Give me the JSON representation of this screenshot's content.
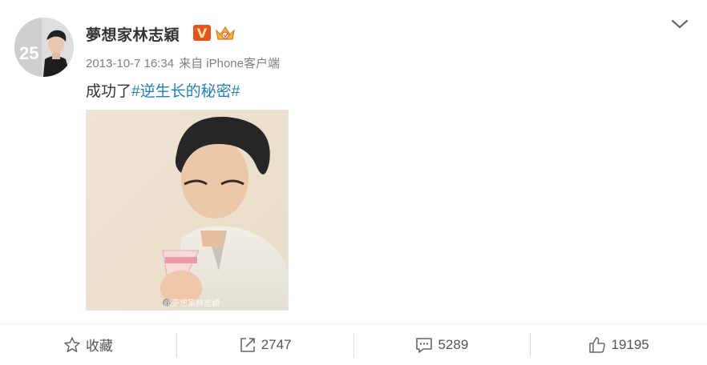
{
  "post": {
    "username": "夢想家林志穎",
    "verified_badge": "V",
    "badge_icons": [
      "verified-v-icon",
      "crown-badge-icon"
    ],
    "timestamp": "2013-10-7 16:34",
    "source": "来自 iPhone客户端",
    "text_prefix": "成功了",
    "hashtag": "#逆生长的秘密#",
    "avatar_overlay": "25",
    "image_watermark": "@夢想家林志穎"
  },
  "actions": [
    {
      "icon": "star-icon",
      "label": "收藏"
    },
    {
      "icon": "share-icon",
      "label": "2747"
    },
    {
      "icon": "comment-icon",
      "label": "5289"
    },
    {
      "icon": "thumbs-up-icon",
      "label": "19195"
    }
  ],
  "colors": {
    "hashtag": "#1e7fbf",
    "meta": "#808080",
    "verified_badge_bg": "#e8531c"
  }
}
